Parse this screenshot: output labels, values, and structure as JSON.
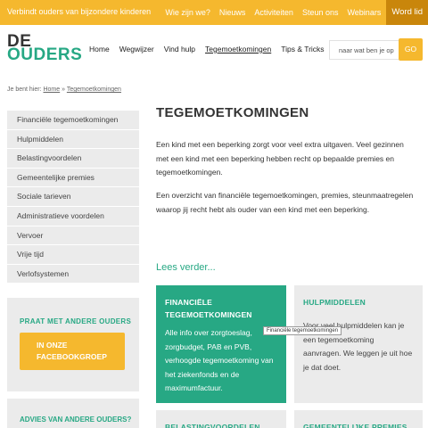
{
  "topbar": {
    "tagline": "Verbindt ouders van bijzondere kinderen",
    "links": [
      "Wie zijn we?",
      "Nieuws",
      "Activiteiten",
      "Steun ons",
      "Webinars"
    ],
    "member_button": "Word lid"
  },
  "logo": {
    "line1": "DE",
    "line2": "OUDERS"
  },
  "nav": {
    "items": [
      "Home",
      "Wegwijzer",
      "Vind hulp",
      "Tegemoetkomingen",
      "Tips & Tricks"
    ],
    "active": "Tegemoetkomingen"
  },
  "search": {
    "placeholder": "naar wat ben je op",
    "button": "GO"
  },
  "breadcrumb": {
    "prefix": "Je bent hier:",
    "home": "Home",
    "separator": "»",
    "current": "Tegemoetkomingen"
  },
  "sidebar": {
    "items": [
      "Financiële tegemoetkomingen",
      "Hulpmiddelen",
      "Belastingvoordelen",
      "Gemeentelijke premies",
      "Sociale tarieven",
      "Administratieve voordelen",
      "Vervoer",
      "Vrije tijd",
      "Verlofsystemen"
    ]
  },
  "promo": {
    "title": "PRAAT MET ANDERE OUDERS",
    "button": "IN ONZE FACEBOOKGROEP",
    "title2": "ADVIES VAN ANDERE OUDERS?"
  },
  "main": {
    "title": "TEGEMOETKOMINGEN",
    "paragraph1": "Een kind met een beperking zorgt voor veel extra uitgaven. Veel gezinnen met een kind met een beperking hebben recht op bepaalde premies en tegemoetkomingen.",
    "paragraph2": "Een overzicht van financiële tegemoetkomingen, premies, steunmaatregelen waarop jij recht hebt als ouder van een kind met een beperking.",
    "read_more": "Lees verder..."
  },
  "cards": [
    {
      "title": "FINANCIËLE TEGEMOETKOMINGEN",
      "body": "Alle info over zorgtoeslag, zorgbudget, PAB en PVB, verhoogde tegemoetkoming van het ziekenfonds en de maximumfactuur."
    },
    {
      "title": "HULPMIDDELEN",
      "body": "Voor veel hulpmiddelen kan je een tegemoetkoming aanvragen. We leggen je uit hoe je dat doet."
    },
    {
      "title": "BELASTINGVOORDELEN",
      "body": ""
    },
    {
      "title": "GEMEENTELIJKE PREMIES",
      "body": ""
    }
  ],
  "tooltip": "Financiële tegemoetkomingen",
  "colors": {
    "yellow": "#f5b82e",
    "green": "#27a884",
    "dark_yellow": "#c9860b",
    "grey": "#ebebeb"
  }
}
